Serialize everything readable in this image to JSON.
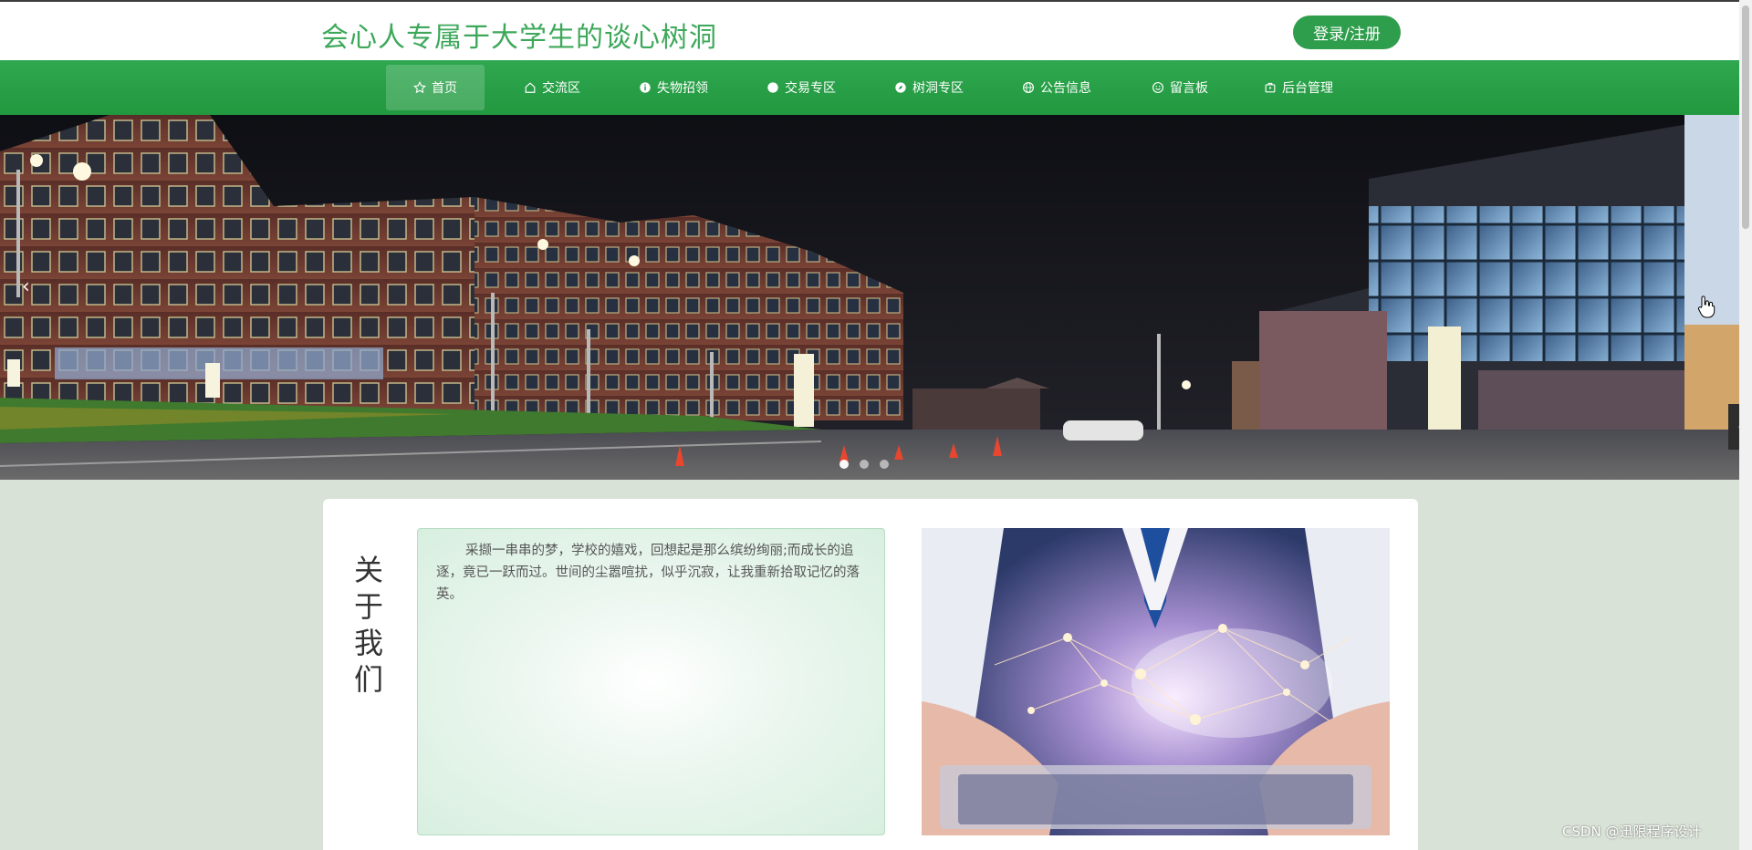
{
  "header": {
    "site_title": "会心人专属于大学生的谈心树洞",
    "login_label": "登录/注册"
  },
  "nav": {
    "items": [
      {
        "label": "首页",
        "icon": "star-icon",
        "active": true
      },
      {
        "label": "交流区",
        "icon": "home-icon"
      },
      {
        "label": "失物招领",
        "icon": "info-circle-icon"
      },
      {
        "label": "交易专区",
        "icon": "circle-icon"
      },
      {
        "label": "树洞专区",
        "icon": "compass-icon"
      },
      {
        "label": "公告信息",
        "icon": "globe-icon"
      },
      {
        "label": "留言板",
        "icon": "smile-icon"
      },
      {
        "label": "后台管理",
        "icon": "briefcase-icon"
      }
    ]
  },
  "banner": {
    "prev_arrow": "‹",
    "side_tab_arrow": "‹",
    "slide_count": 3,
    "active_slide": 0
  },
  "about": {
    "title": "关于我们",
    "text": "采撷一串串的梦，学校的嬉戏，回想起是那么缤纷绚丽;而成长的追逐，竟已一跃而过。世间的尘嚣喧扰，似乎沉寂，让我重新拾取记忆的落英。"
  },
  "watermark": "CSDN @迅限程序设计",
  "colors": {
    "brand_green": "#2f9e4c",
    "title_green": "#3da85a",
    "nav_green": "#22983f",
    "page_bg": "#d9e2d6"
  }
}
